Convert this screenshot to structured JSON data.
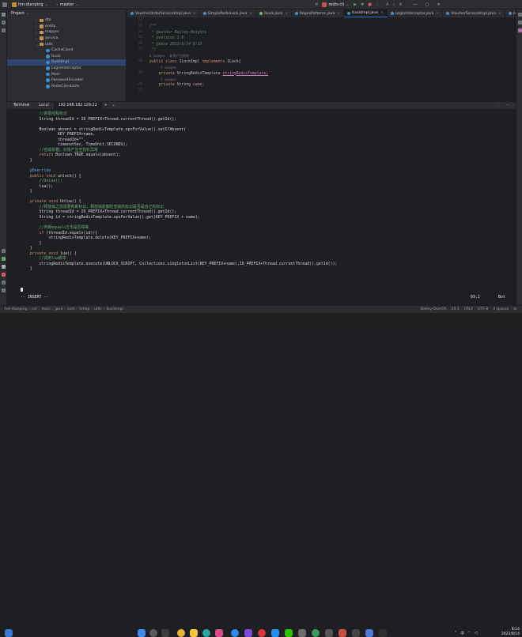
{
  "titlebar": {
    "project": "hm-dianping",
    "branch": "master",
    "run_config": "redis-cli"
  },
  "project_panel": {
    "title": "Project",
    "tree": [
      {
        "label": "dto",
        "kind": "dir",
        "indent": 4,
        "arrow": "›"
      },
      {
        "label": "entity",
        "kind": "dir",
        "indent": 4,
        "arrow": "›"
      },
      {
        "label": "mapper",
        "kind": "dir",
        "indent": 4,
        "arrow": "›"
      },
      {
        "label": "service",
        "kind": "dir",
        "indent": 4,
        "arrow": "›"
      },
      {
        "label": "utils",
        "kind": "dir",
        "indent": 4,
        "arrow": "⌄"
      },
      {
        "label": "CacheClient",
        "kind": "cls",
        "indent": 5,
        "arrow": ""
      },
      {
        "label": "ILock",
        "kind": "cls",
        "indent": 5,
        "arrow": ""
      },
      {
        "label": "ILockImpl",
        "kind": "cls",
        "indent": 5,
        "arrow": "",
        "selected": true
      },
      {
        "label": "LoginInterceptor",
        "kind": "cls",
        "indent": 5,
        "arrow": ""
      },
      {
        "label": "Main",
        "kind": "cls",
        "indent": 5,
        "arrow": ""
      },
      {
        "label": "PasswordEncoder",
        "kind": "cls",
        "indent": 5,
        "arrow": ""
      },
      {
        "label": "RedisConstants",
        "kind": "cls",
        "indent": 5,
        "arrow": ""
      }
    ]
  },
  "editor_tabs": [
    {
      "label": "VoucherOrderServiceImpl.java",
      "color": "#3d8fd1"
    },
    {
      "label": "SimpleRedisLock.java",
      "color": "#3d8fd1"
    },
    {
      "label": "ILock.java",
      "color": "#6fb46f"
    },
    {
      "label": "RegexPatterns.java",
      "color": "#3d8fd1"
    },
    {
      "label": "ILockImpl.java",
      "color": "#3d8fd1",
      "active": true
    },
    {
      "label": "LoginInterceptor.java",
      "color": "#3d8fd1"
    },
    {
      "label": "VoucherServiceImpl.java",
      "color": "#3d8fd1"
    },
    {
      "label": "order.xl",
      "color": "#3d8fd1"
    }
  ],
  "editor": {
    "line_numbers": [
      "12",
      "13",
      "14",
      "15",
      "16",
      "17",
      "",
      "18",
      "",
      "19",
      "",
      "20",
      "21"
    ],
    "inspections": "▲1  ▲3  ✓1",
    "lines": [
      {
        "type": "blank"
      },
      {
        "type": "doc",
        "text": "/**"
      },
      {
        "type": "doc",
        "text": " * @author Bailey-Heights"
      },
      {
        "type": "doc",
        "text": " * @version 1.0"
      },
      {
        "type": "doc",
        "text": " * @date 2023/8/14 8:15"
      },
      {
        "type": "doc",
        "text": " */"
      },
      {
        "type": "hint",
        "text": "6 usages  新用户注册的"
      },
      {
        "type": "classdecl",
        "text": ""
      },
      {
        "type": "hint2",
        "text": "3 usages"
      },
      {
        "type": "field1",
        "text": ""
      },
      {
        "type": "hint2",
        "text": "3 usages"
      },
      {
        "type": "field2",
        "text": ""
      },
      {
        "type": "blank"
      }
    ],
    "tokens": {
      "public": "public",
      "class": "class",
      "classname": "ILockImpl",
      "implements": "implements",
      "iface": "ILock{",
      "private": "private",
      "type1": "StringRedisTemplate",
      "field1": "stringRedisTemplate;",
      "type2": "String",
      "field2": "name;"
    }
  },
  "terminal": {
    "tab_label": "Terminal",
    "tabs": [
      "Local",
      "192.168.182.128:22",
      "+",
      "⌄"
    ],
    "lines": [
      [
        [
          "tg",
          "        //获取线程标识"
        ]
      ],
      [
        [
          "",
          "        String threadId = ID_PREFIX+Thread.currentThread().getId();"
        ]
      ],
      [
        [
          "",
          ""
        ]
      ],
      [
        [
          "",
          "        Boolean absent = stringRedisTemplate.opsForValue().setIfAbsent("
        ]
      ],
      [
        [
          "",
          "                KEY_PREFIX+name,"
        ]
      ],
      [
        [
          "",
          "                threadId+\"\","
        ]
      ],
      [
        [
          "",
          "                timeoutSec, TimeUnit.SECONDS);"
        ]
      ],
      [
        [
          "tg",
          "        //自动拆箱，对象产生空指针异常"
        ]
      ],
      [
        [
          "tk",
          "        return "
        ],
        [
          "",
          "Boolean.TRUE.equals(absent);"
        ]
      ],
      [
        [
          "",
          "    }"
        ]
      ],
      [
        [
          "",
          ""
        ]
      ],
      [
        [
          "tb",
          "    @Override"
        ]
      ],
      [
        [
          "tk",
          "    public void "
        ],
        [
          "",
          "unlock() {"
        ]
      ],
      [
        [
          "tg",
          "        //Unlua();"
        ]
      ],
      [
        [
          "",
          "        lua();"
        ]
      ],
      [
        [
          "",
          "    }"
        ]
      ],
      [
        [
          "",
          ""
        ]
      ],
      [
        [
          "tk",
          "    private void "
        ],
        [
          "",
          "Unlua() {"
        ]
      ],
      [
        [
          "tg",
          "        //释放锁之前需要判断标识，释放锁前都检查锁的标识是否是自己的标识"
        ]
      ],
      [
        [
          "",
          "        String threadId = ID_PREFIX+Thread.currentThread().getId();"
        ]
      ],
      [
        [
          "",
          "        String id = stringRedisTemplate.opsForValue().get(KEY_PREFIX + name);"
        ]
      ],
      [
        [
          "",
          ""
        ]
      ],
      [
        [
          "tg",
          "        //判断equals方法是否相等"
        ]
      ],
      [
        [
          "tk",
          "        if "
        ],
        [
          "",
          "(threadId.equals(id)){"
        ]
      ],
      [
        [
          "",
          "            stringRedisTemplate.delete(KEY_PREFIX+name);"
        ]
      ],
      [
        [
          "",
          "        }"
        ]
      ],
      [
        [
          "",
          "    }"
        ]
      ],
      [
        [
          "tk",
          "    private void "
        ],
        [
          "",
          "lua() {"
        ]
      ],
      [
        [
          "tg",
          "        //调用lua脚本"
        ]
      ],
      [
        [
          "",
          "        stringRedisTemplate.execute(UNLOCK_SCRIPT, Collections.singletonList(KEY_PREFIX+name),ID_PREFIX+Thread.currentThread().getId());"
        ]
      ],
      [
        [
          "",
          "    }"
        ]
      ]
    ],
    "insert_mode": "-- INSERT --",
    "position": "69,2",
    "scroll": "Bot"
  },
  "statusbar": {
    "breadcrumb": [
      "hm-dianping",
      "src",
      "main",
      "java",
      "com",
      "hmdp",
      "utils",
      "ILockImpl"
    ],
    "author": "Bailey-OverOh",
    "line_col": "25:1",
    "line_sep": "CRLF",
    "encoding": "UTF-8",
    "indent": "4 spaces"
  },
  "taskbar": {
    "time": "8:14",
    "date": "2023/8/14"
  }
}
